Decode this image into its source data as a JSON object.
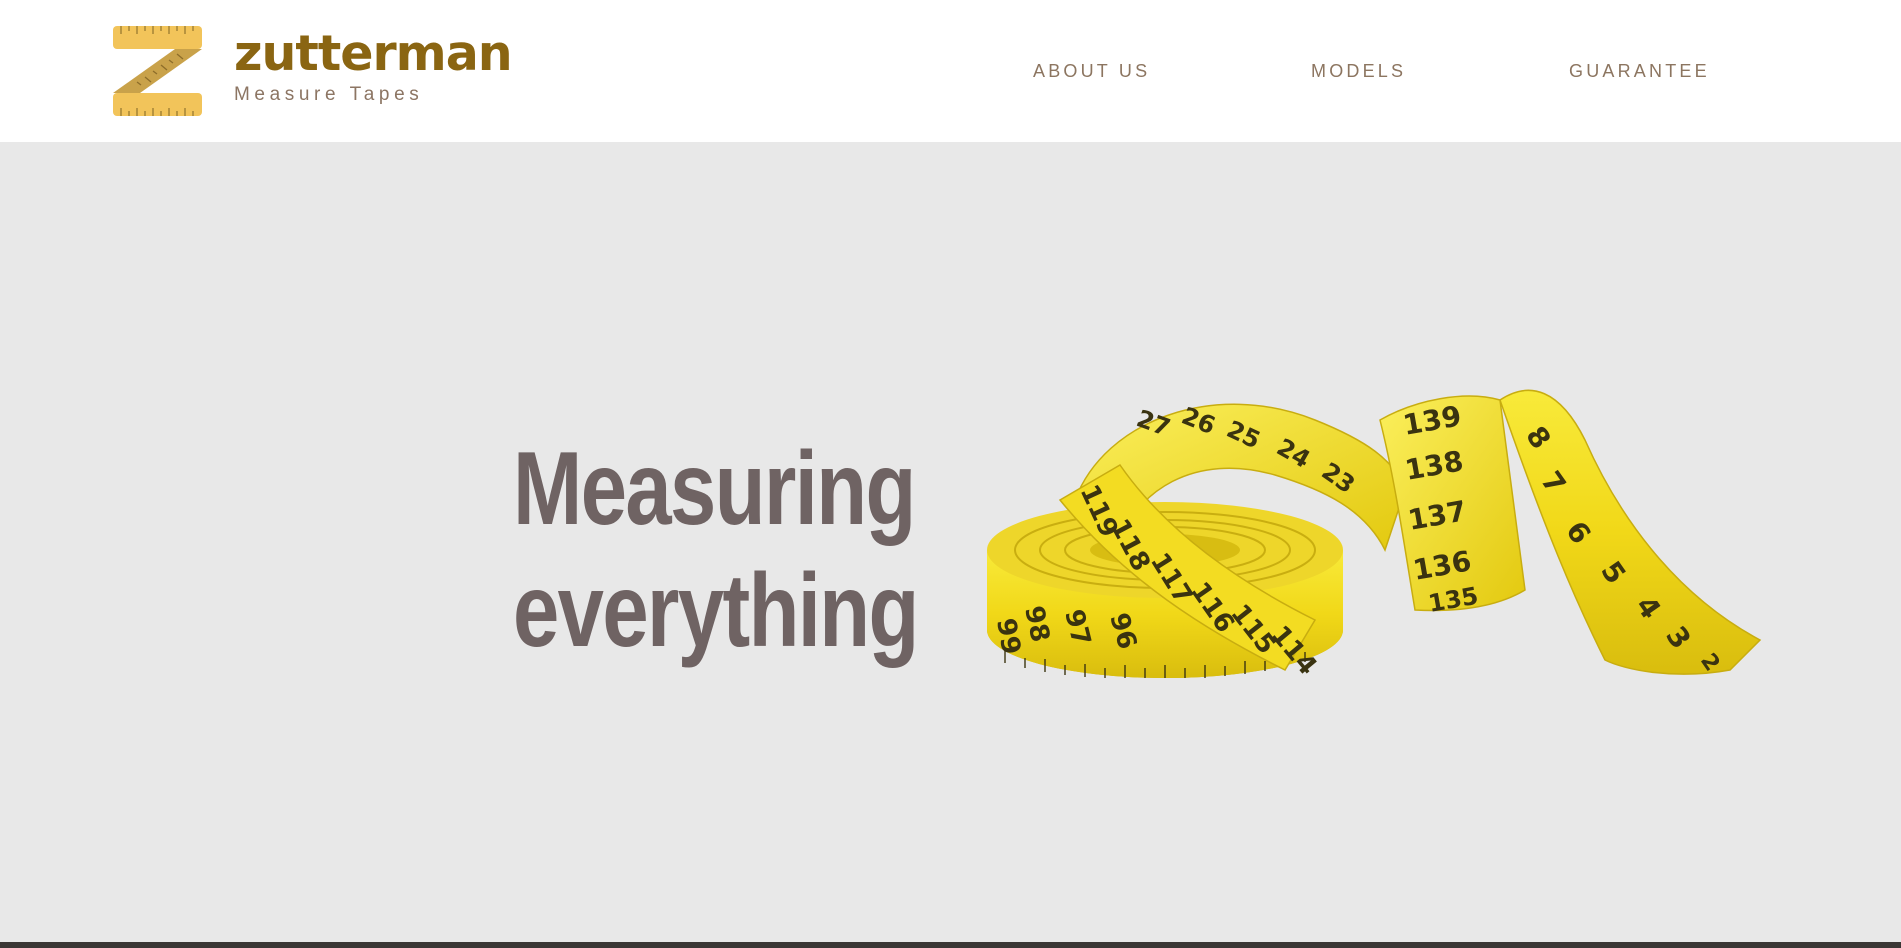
{
  "header": {
    "brand": {
      "name": "zutterman",
      "tagline": "Measure Tapes",
      "logo_icon": "tape-z-logo-icon"
    },
    "nav": [
      {
        "label": "ABOUT US"
      },
      {
        "label": "MODELS"
      },
      {
        "label": "GUARANTEE"
      }
    ]
  },
  "hero": {
    "heading_line1": "Measuring",
    "heading_line2": "everything",
    "image": "tape-measure-roll-image",
    "tape_numbers": {
      "coil_front": [
        "99",
        "98",
        "97",
        "96"
      ],
      "coil_top": [
        "27",
        "26",
        "25",
        "24",
        "23"
      ],
      "strip_middle": [
        "119",
        "118",
        "117",
        "116",
        "115",
        "114"
      ],
      "strip_right": [
        "139",
        "138",
        "137",
        "136",
        "135"
      ],
      "end": [
        "8",
        "7",
        "6",
        "5",
        "4",
        "3",
        "2"
      ]
    }
  },
  "colors": {
    "brand": "#8a6512",
    "nav": "#8c7560",
    "heading": "#6f6363",
    "hero_bg": "#e8e8e8",
    "tape_yellow": "#f4df20",
    "logo_yellow": "#f2c45a"
  }
}
